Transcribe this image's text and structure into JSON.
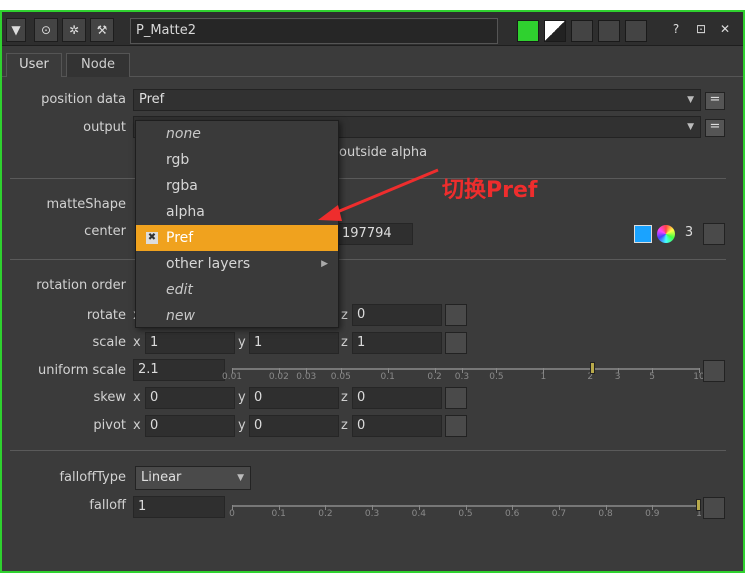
{
  "window": {
    "node_name": "P_Matte2",
    "buttons": {
      "help": "?",
      "float": "⊡",
      "close": "✕"
    }
  },
  "tabs": [
    {
      "label": "User"
    },
    {
      "label": "Node"
    }
  ],
  "position_data": {
    "label": "position data",
    "value": "Pref"
  },
  "output": {
    "label": "output",
    "value": ""
  },
  "outside_alpha_text": "outside alpha",
  "dropdown_menu": {
    "items": [
      {
        "label": "none"
      },
      {
        "label": "rgb"
      },
      {
        "label": "rgba"
      },
      {
        "label": "alpha"
      },
      {
        "label": "Pref"
      },
      {
        "label": "other layers"
      },
      {
        "label": "edit"
      },
      {
        "label": "new"
      }
    ],
    "selected_index": 4
  },
  "annotation": "切换Pref",
  "matteShape": {
    "label": "matteShape"
  },
  "center": {
    "label": "center",
    "value": "197794",
    "channels": "3"
  },
  "rotation_order": {
    "label": "rotation order"
  },
  "axis_labels": {
    "x": "x",
    "y": "y",
    "z": "z"
  },
  "rotate": {
    "label": "rotate",
    "x": "0",
    "y": "0",
    "z": "0"
  },
  "scale": {
    "label": "scale",
    "x": "1",
    "y": "1",
    "z": "1"
  },
  "uniform_scale": {
    "label": "uniform scale",
    "value": "2.1"
  },
  "uniform_scale_ticks": [
    "0.01",
    "0.02",
    "0.03",
    "0.05",
    "0.1",
    "0.2",
    "0.3",
    "0.5",
    "1",
    "2",
    "3",
    "5",
    "10"
  ],
  "skew": {
    "label": "skew",
    "x": "0",
    "y": "0",
    "z": "0"
  },
  "pivot": {
    "label": "pivot",
    "x": "0",
    "y": "0",
    "z": "0"
  },
  "falloffType": {
    "label": "falloffType",
    "value": "Linear"
  },
  "falloff": {
    "label": "falloff",
    "value": "1"
  },
  "falloff_ticks": [
    "0",
    "0.1",
    "0.2",
    "0.3",
    "0.4",
    "0.5",
    "0.6",
    "0.7",
    "0.8",
    "0.9",
    "1"
  ],
  "colors": {
    "accent_border": "#2fd12f",
    "menu_highlight": "#f0a21e",
    "annotation": "#ee2d2d"
  }
}
